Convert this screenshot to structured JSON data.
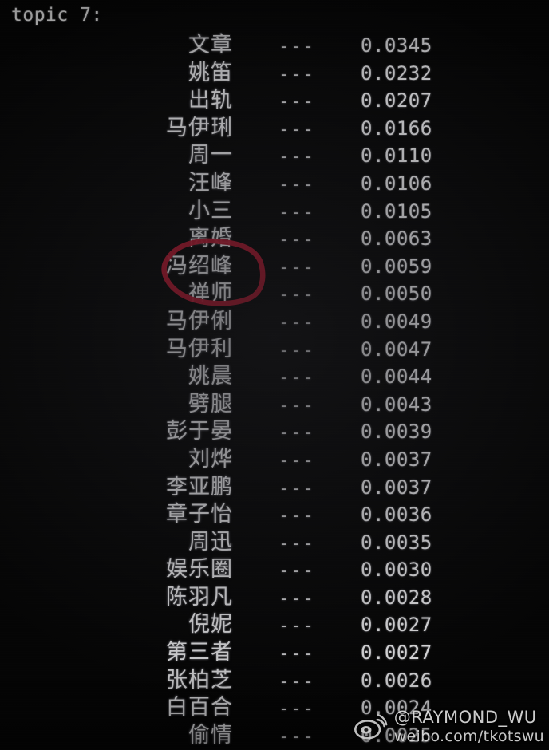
{
  "terminal": {
    "title": "topic 7:",
    "separator": "---",
    "rows": [
      {
        "term": "文章",
        "value": "0.0345"
      },
      {
        "term": "姚笛",
        "value": "0.0232"
      },
      {
        "term": "出轨",
        "value": "0.0207"
      },
      {
        "term": "马伊琍",
        "value": "0.0166"
      },
      {
        "term": "周一",
        "value": "0.0110"
      },
      {
        "term": "汪峰",
        "value": "0.0106"
      },
      {
        "term": "小三",
        "value": "0.0105"
      },
      {
        "term": "离婚",
        "value": "0.0063"
      },
      {
        "term": "冯绍峰",
        "value": "0.0059"
      },
      {
        "term": "禅师",
        "value": "0.0050"
      },
      {
        "term": "马伊俐",
        "value": "0.0049"
      },
      {
        "term": "马伊利",
        "value": "0.0047"
      },
      {
        "term": "姚晨",
        "value": "0.0044"
      },
      {
        "term": "劈腿",
        "value": "0.0043"
      },
      {
        "term": "彭于晏",
        "value": "0.0039"
      },
      {
        "term": "刘烨",
        "value": "0.0037"
      },
      {
        "term": "李亚鹏",
        "value": "0.0037"
      },
      {
        "term": "章子怡",
        "value": "0.0036"
      },
      {
        "term": "周迅",
        "value": "0.0035"
      },
      {
        "term": "娱乐圈",
        "value": "0.0030"
      },
      {
        "term": "陈羽凡",
        "value": "0.0028"
      },
      {
        "term": "倪妮",
        "value": "0.0027"
      },
      {
        "term": "第三者",
        "value": "0.0027"
      },
      {
        "term": "张柏芝",
        "value": "0.0026"
      },
      {
        "term": "白百合",
        "value": "0.0024"
      },
      {
        "term": "偷情",
        "value": "0.0025"
      }
    ]
  },
  "annotation": {
    "kind": "hand-drawn-circle",
    "color": "#a3152a",
    "encircles": [
      "冯绍峰",
      "禅师"
    ]
  },
  "watermark": {
    "handle": "@RAYMOND_WU",
    "url": "weibo.com/tkotswu",
    "logo": "weibo-logo-icon"
  },
  "colors": {
    "background": "#050505",
    "text": "#d2d2d4",
    "annotation_red": "#a3152a"
  }
}
